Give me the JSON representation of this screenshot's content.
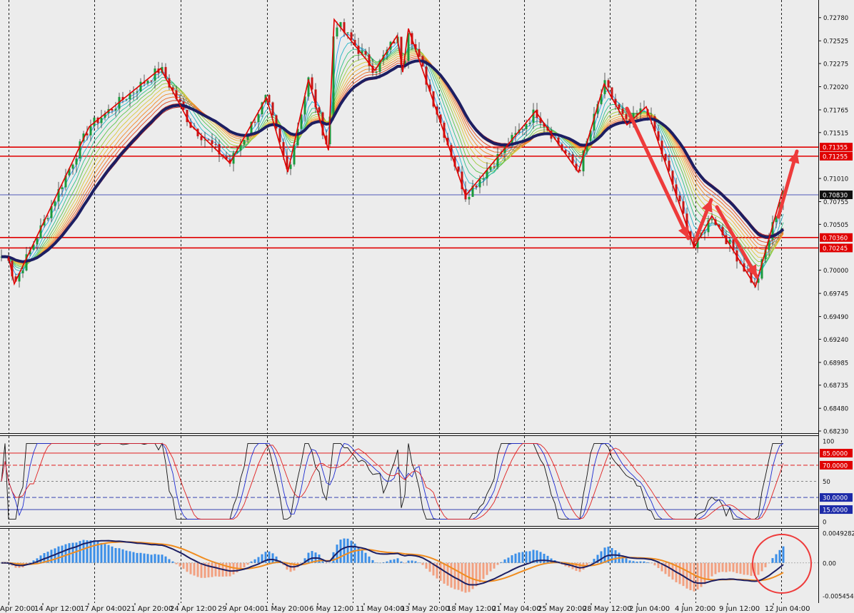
{
  "chart_data": [
    {
      "type": "candlestick",
      "ylim": [
        0.6823,
        0.7288
      ],
      "y_ticks": [
        "0.72780",
        "0.72525",
        "0.72275",
        "0.72020",
        "0.71765",
        "0.71515",
        "0.71010",
        "0.70755",
        "0.70505",
        "0.70000",
        "0.69745",
        "0.69490",
        "0.69240",
        "0.68985",
        "0.68735",
        "0.68480",
        "0.68230"
      ],
      "horizontal_levels": [
        {
          "label": "0.71355",
          "value": 0.71355,
          "color": "#e00000"
        },
        {
          "label": "0.71255",
          "value": 0.71255,
          "color": "#e00000"
        },
        {
          "label": "0.70830",
          "value": 0.7083,
          "color": "#1c2aa8"
        },
        {
          "label": "0.70360",
          "value": 0.7036,
          "color": "#e00000"
        },
        {
          "label": "0.70245",
          "value": 0.70245,
          "color": "#e00000"
        }
      ],
      "zigzag_pivots": [
        0.7015,
        0.6985,
        0.7158,
        0.7222,
        0.716,
        0.7118,
        0.719,
        0.7108,
        0.721,
        0.7132,
        0.7276,
        0.722,
        0.7258,
        0.7218,
        0.7266,
        0.7082,
        0.7175,
        0.7108,
        0.7205,
        0.716,
        0.718,
        0.7025,
        0.706,
        0.6982,
        0.7088
      ]
    },
    {
      "type": "line",
      "name": "stochastic",
      "ylim": [
        0,
        100
      ],
      "y_ticks": [
        "100",
        "50",
        "0"
      ],
      "levels": [
        {
          "label": "85.0000",
          "value": 85,
          "color": "#e00000"
        },
        {
          "label": "70.0000",
          "value": 70,
          "color": "#e00000"
        },
        {
          "label": "30.0000",
          "value": 30,
          "color": "#1c2aa8"
        },
        {
          "label": "15.0000",
          "value": 15,
          "color": "#1c2aa8"
        }
      ]
    },
    {
      "type": "histogram",
      "name": "macd",
      "y_ticks": [
        "0.0049282",
        "0.00",
        "-0.005454"
      ],
      "ylim": [
        -0.005454,
        0.0049282
      ]
    }
  ],
  "x_axis": {
    "labels": [
      "Apr 20:00",
      "14 Apr 12:00",
      "17 Apr 04:00",
      "21 Apr 20:00",
      "24 Apr 12:00",
      "29 Apr 04:00",
      "1 May 20:00",
      "6 May 12:00",
      "11 May 04:00",
      "13 May 20:00",
      "18 May 12:00",
      "21 May 04:00",
      "25 May 20:00",
      "28 May 12:00",
      "2 Jun 04:00",
      "4 Jun 20:00",
      "9 Jun 12:00",
      "12 Jun 04:00"
    ]
  },
  "colors": {
    "background": "#ececec",
    "bull": "#1a9a3c",
    "bear": "#c81414",
    "zigzag": "#e00000",
    "slow_ma": "#1c1e62",
    "arrow": "#ee3b3b",
    "histogram_positive": "#3a8ee8",
    "histogram_negative": "#f2a080",
    "macd_signal": "#f08c1e"
  }
}
